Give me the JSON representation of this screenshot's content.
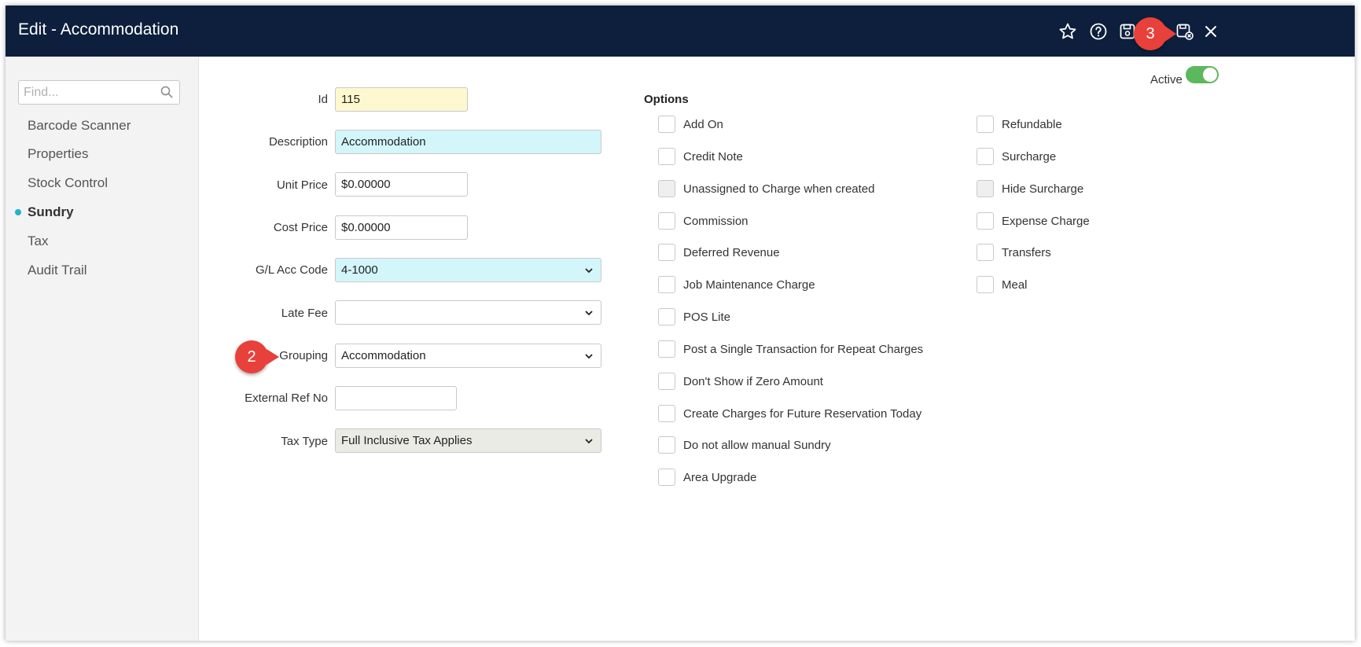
{
  "window": {
    "title": "Edit - Accommodation"
  },
  "toolbar": {
    "icons": [
      "star-icon",
      "help-icon",
      "save-icon",
      "save-close-icon",
      "close-icon"
    ]
  },
  "sidebar": {
    "search_placeholder": "Find...",
    "items": [
      {
        "label": "Barcode Scanner"
      },
      {
        "label": "Properties"
      },
      {
        "label": "Stock Control"
      },
      {
        "label": "Sundry",
        "active": true
      },
      {
        "label": "Tax"
      },
      {
        "label": "Audit Trail"
      }
    ]
  },
  "form": {
    "id": {
      "label": "Id",
      "value": "115"
    },
    "description": {
      "label": "Description",
      "value": "Accommodation"
    },
    "unit_price": {
      "label": "Unit Price",
      "value": "$0.00000"
    },
    "cost_price": {
      "label": "Cost Price",
      "value": "$0.00000"
    },
    "gl_acc_code": {
      "label": "G/L Acc Code",
      "value": "4-1000"
    },
    "late_fee": {
      "label": "Late Fee",
      "value": ""
    },
    "grouping": {
      "label": "Grouping",
      "value": "Accommodation"
    },
    "external_ref": {
      "label": "External Ref No",
      "value": ""
    },
    "tax_type": {
      "label": "Tax Type",
      "value": "Full Inclusive Tax Applies"
    }
  },
  "options": {
    "title": "Options",
    "left": [
      {
        "label": "Add On",
        "checked": false,
        "disabled": false
      },
      {
        "label": "Credit Note",
        "checked": false,
        "disabled": false
      },
      {
        "label": "Unassigned to Charge when created",
        "checked": false,
        "disabled": true
      },
      {
        "label": "Commission",
        "checked": false,
        "disabled": false
      },
      {
        "label": "Deferred Revenue",
        "checked": false,
        "disabled": false
      },
      {
        "label": "Job Maintenance Charge",
        "checked": false,
        "disabled": false
      },
      {
        "label": "POS Lite",
        "checked": false,
        "disabled": false
      },
      {
        "label": "Post a Single Transaction for Repeat Charges",
        "checked": false,
        "disabled": false
      },
      {
        "label": "Don't Show if Zero Amount",
        "checked": false,
        "disabled": false
      },
      {
        "label": "Create Charges for Future Reservation Today",
        "checked": false,
        "disabled": false
      },
      {
        "label": "Do not allow manual Sundry",
        "checked": false,
        "disabled": false
      },
      {
        "label": "Area Upgrade",
        "checked": false,
        "disabled": false
      }
    ],
    "right": [
      {
        "label": "Refundable",
        "checked": false,
        "disabled": false
      },
      {
        "label": "Surcharge",
        "checked": false,
        "disabled": false
      },
      {
        "label": "Hide Surcharge",
        "checked": false,
        "disabled": true
      },
      {
        "label": "Expense Charge",
        "checked": false,
        "disabled": false
      },
      {
        "label": "Transfers",
        "checked": false,
        "disabled": false
      },
      {
        "label": "Meal",
        "checked": false,
        "disabled": false
      }
    ]
  },
  "active_toggle": {
    "label": "Active",
    "on": true,
    "color": "#5cb85c"
  },
  "callouts": [
    {
      "text": "2"
    },
    {
      "text": "3"
    }
  ],
  "colors": {
    "titlebar": "#0d1f3c",
    "accent": "#1fb5c9",
    "callout": "#e8403a"
  }
}
